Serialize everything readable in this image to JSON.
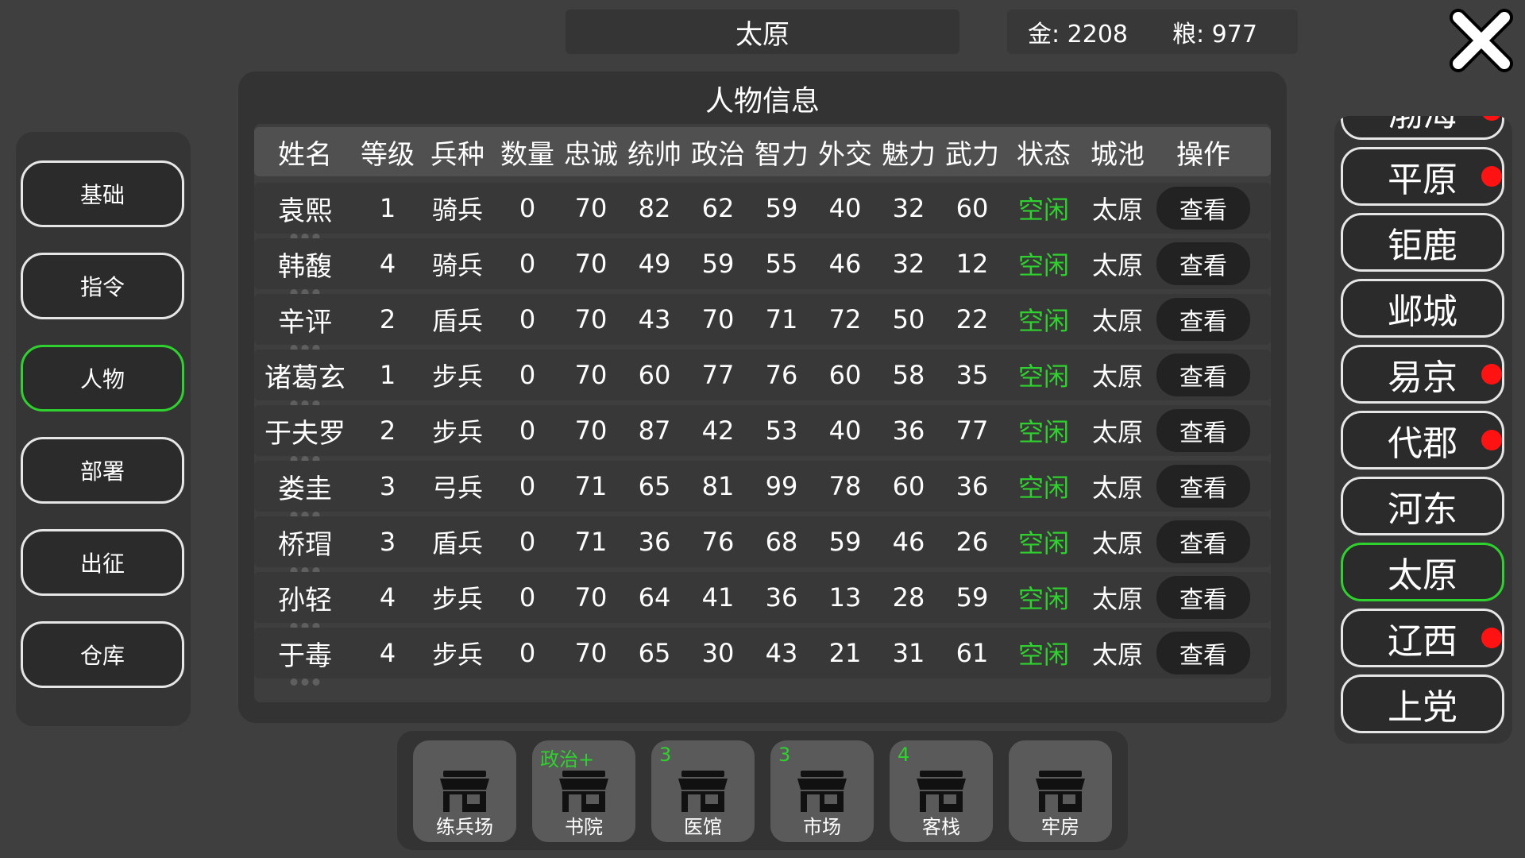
{
  "top_bar": {
    "city_title": "太原",
    "gold": "金: 2208",
    "grain": "粮: 977"
  },
  "left_menu": {
    "items": [
      {
        "label": "基础"
      },
      {
        "label": "指令"
      },
      {
        "label": "人物"
      },
      {
        "label": "部署"
      },
      {
        "label": "出征"
      },
      {
        "label": "仓库"
      }
    ],
    "active": "人物"
  },
  "panel": {
    "title": "人物信息",
    "headers": [
      "姓名",
      "等级",
      "兵种",
      "数量",
      "忠诚",
      "统帅",
      "政治",
      "智力",
      "外交",
      "魅力",
      "武力",
      "状态",
      "城池",
      "操作"
    ],
    "rows": [
      {
        "name": "袁熙",
        "level": "1",
        "troop": "骑兵",
        "count": "0",
        "loyalty": "70",
        "command": "82",
        "politics": "62",
        "intellect": "59",
        "diplomacy": "40",
        "charm": "32",
        "force": "60",
        "state": "空闲",
        "city": "太原",
        "action": "查看"
      },
      {
        "name": "韩馥",
        "level": "4",
        "troop": "骑兵",
        "count": "0",
        "loyalty": "70",
        "command": "49",
        "politics": "59",
        "intellect": "55",
        "diplomacy": "46",
        "charm": "32",
        "force": "12",
        "state": "空闲",
        "city": "太原",
        "action": "查看"
      },
      {
        "name": "辛评",
        "level": "2",
        "troop": "盾兵",
        "count": "0",
        "loyalty": "70",
        "command": "43",
        "politics": "70",
        "intellect": "71",
        "diplomacy": "72",
        "charm": "50",
        "force": "22",
        "state": "空闲",
        "city": "太原",
        "action": "查看"
      },
      {
        "name": "诸葛玄",
        "level": "1",
        "troop": "步兵",
        "count": "0",
        "loyalty": "70",
        "command": "60",
        "politics": "77",
        "intellect": "76",
        "diplomacy": "60",
        "charm": "58",
        "force": "35",
        "state": "空闲",
        "city": "太原",
        "action": "查看"
      },
      {
        "name": "于夫罗",
        "level": "2",
        "troop": "步兵",
        "count": "0",
        "loyalty": "70",
        "command": "87",
        "politics": "42",
        "intellect": "53",
        "diplomacy": "40",
        "charm": "36",
        "force": "77",
        "state": "空闲",
        "city": "太原",
        "action": "查看"
      },
      {
        "name": "娄圭",
        "level": "3",
        "troop": "弓兵",
        "count": "0",
        "loyalty": "71",
        "command": "65",
        "politics": "81",
        "intellect": "99",
        "diplomacy": "78",
        "charm": "60",
        "force": "36",
        "state": "空闲",
        "city": "太原",
        "action": "查看"
      },
      {
        "name": "桥瑁",
        "level": "3",
        "troop": "盾兵",
        "count": "0",
        "loyalty": "71",
        "command": "36",
        "politics": "76",
        "intellect": "68",
        "diplomacy": "59",
        "charm": "46",
        "force": "26",
        "state": "空闲",
        "city": "太原",
        "action": "查看"
      },
      {
        "name": "孙轻",
        "level": "4",
        "troop": "步兵",
        "count": "0",
        "loyalty": "70",
        "command": "64",
        "politics": "41",
        "intellect": "36",
        "diplomacy": "13",
        "charm": "28",
        "force": "59",
        "state": "空闲",
        "city": "太原",
        "action": "查看"
      },
      {
        "name": "于毒",
        "level": "4",
        "troop": "步兵",
        "count": "0",
        "loyalty": "70",
        "command": "65",
        "politics": "30",
        "intellect": "43",
        "diplomacy": "21",
        "charm": "31",
        "force": "61",
        "state": "空闲",
        "city": "太原",
        "action": "查看"
      }
    ]
  },
  "city_list": {
    "items": [
      {
        "label": "渤海",
        "alert": true
      },
      {
        "label": "平原",
        "alert": true
      },
      {
        "label": "钜鹿",
        "alert": false
      },
      {
        "label": "邺城",
        "alert": false
      },
      {
        "label": "易京",
        "alert": true
      },
      {
        "label": "代郡",
        "alert": true
      },
      {
        "label": "河东",
        "alert": false
      },
      {
        "label": "太原",
        "alert": false
      },
      {
        "label": "辽西",
        "alert": true
      },
      {
        "label": "上党",
        "alert": false
      }
    ],
    "active": "太原"
  },
  "buildings": [
    {
      "label": "练兵场",
      "badge": "",
      "icon": "shop-icon"
    },
    {
      "label": "书院",
      "badge": "政治+",
      "icon": "shop-icon"
    },
    {
      "label": "医馆",
      "badge": "3",
      "icon": "shop-icon"
    },
    {
      "label": "市场",
      "badge": "3",
      "icon": "shop-icon"
    },
    {
      "label": "客栈",
      "badge": "4",
      "icon": "shop-icon"
    },
    {
      "label": "牢房",
      "badge": "",
      "icon": "shop-icon"
    }
  ],
  "colors": {
    "accent_green": "#2fd12f",
    "alert_red": "#ff1212",
    "background": "#3f3f3f"
  }
}
